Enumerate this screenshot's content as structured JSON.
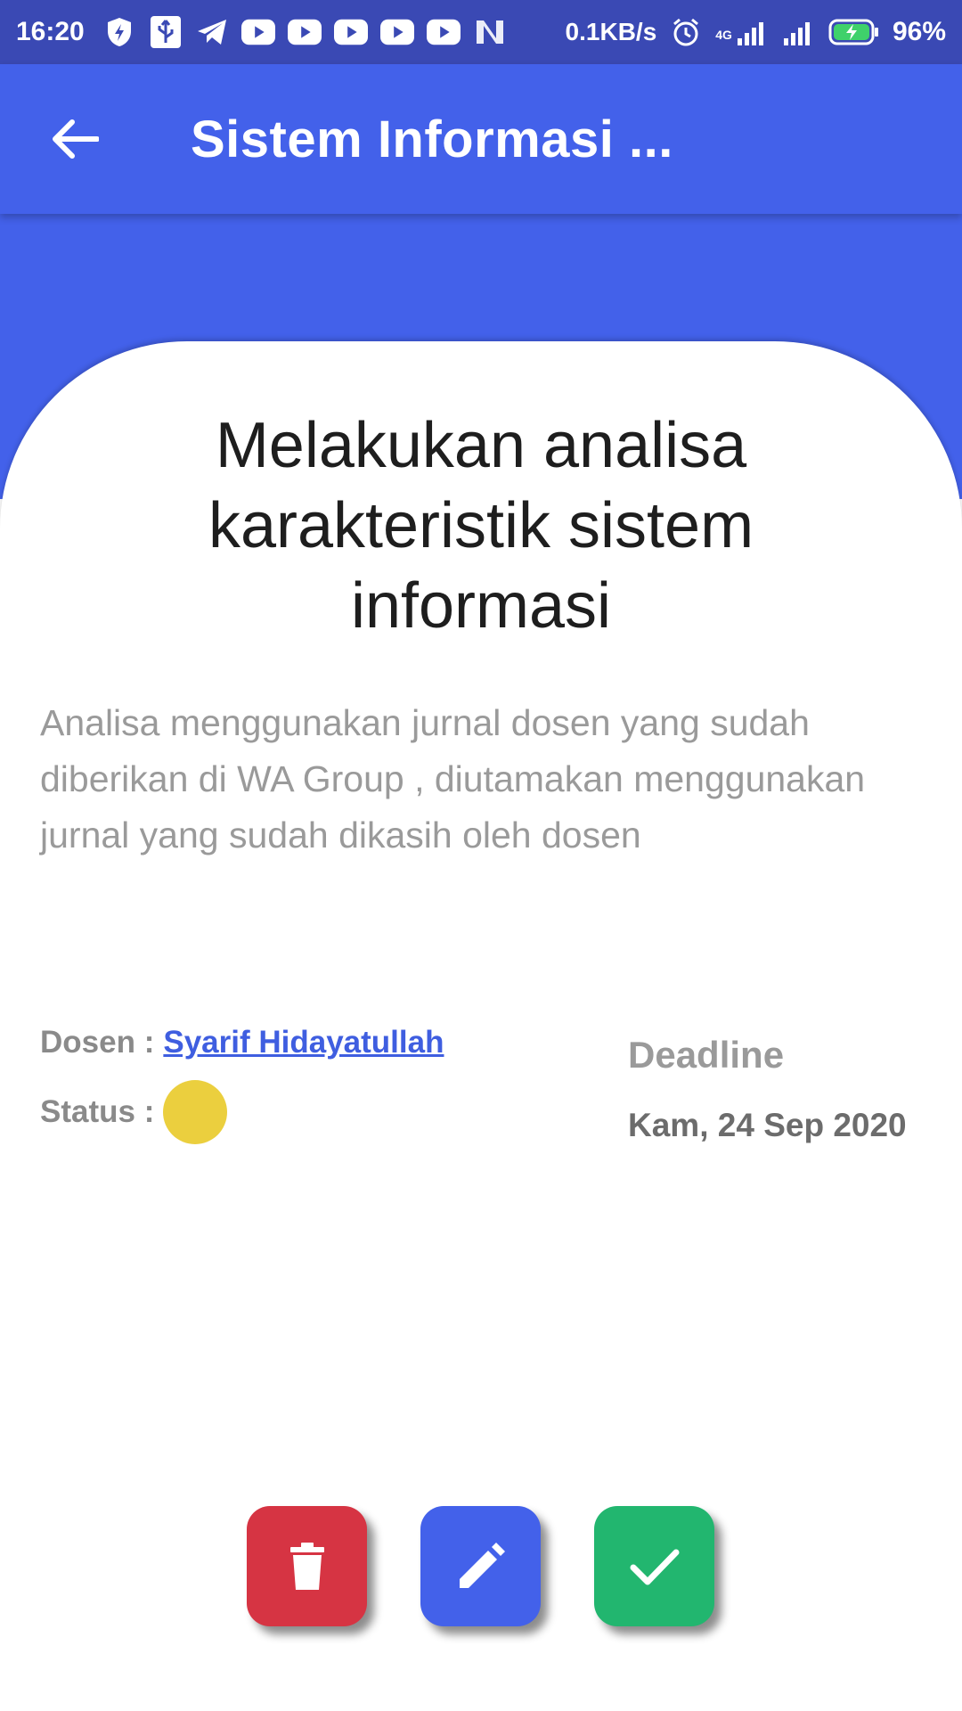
{
  "status_bar": {
    "time": "16:20",
    "network_speed": "0.1KB/s",
    "network_type": "4G",
    "battery": "96%",
    "icons": [
      "shield-icon",
      "usb-icon",
      "telegram-icon",
      "youtube-icon",
      "youtube-icon",
      "youtube-icon",
      "youtube-icon",
      "youtube-icon",
      "n-app-icon",
      "alarm-icon",
      "signal-icon",
      "signal-icon",
      "battery-icon"
    ]
  },
  "app_bar": {
    "title": "Sistem Informasi ...",
    "back_icon": "arrow-back-icon"
  },
  "task": {
    "title": "Melakukan analisa karakteristik sistem informasi",
    "description": "Analisa menggunakan jurnal dosen yang sudah diberikan di WA Group , diutamakan menggunakan jurnal yang sudah dikasih oleh dosen",
    "dosen_label": "Dosen :",
    "dosen_name": "Syarif Hidayatullah",
    "status_label": "Status :",
    "status_color": "#ebcf3e",
    "deadline_label": "Deadline",
    "deadline_date": "Kam, 24 Sep 2020"
  },
  "actions": {
    "delete_icon": "trash-icon",
    "edit_icon": "pencil-icon",
    "done_icon": "check-icon",
    "colors": {
      "delete": "#d63443",
      "edit": "#4361ea",
      "done": "#22b66f"
    }
  },
  "colors": {
    "primary": "#4361ea",
    "status_bar": "#3a49b4"
  }
}
